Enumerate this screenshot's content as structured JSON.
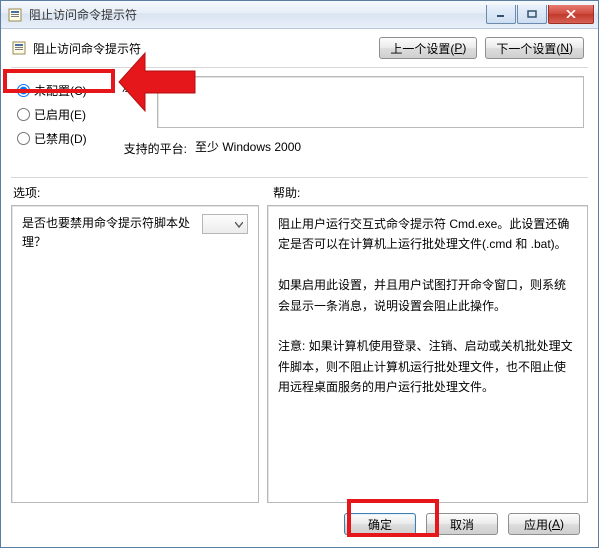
{
  "window": {
    "title": "阻止访问命令提示符"
  },
  "header": {
    "title": "阻止访问命令提示符",
    "prev_label": "上一个设置(",
    "prev_key": "P",
    "next_label": "下一个设置(",
    "next_key": "N",
    "paren_close": ")"
  },
  "radios": {
    "not_configured": "未配置(",
    "not_configured_key": "C",
    "enabled": "已启用(",
    "enabled_key": "E",
    "disabled": "已禁用(",
    "disabled_key": "D",
    "paren_close": ")"
  },
  "labels": {
    "comment": "注释:",
    "supported": "支持的平台:",
    "options": "选项:",
    "help": "帮助:"
  },
  "values": {
    "supported_on": "至少 Windows 2000"
  },
  "options": {
    "question": "是否也要禁用命令提示符脚本处理？"
  },
  "help": {
    "text": "阻止用户运行交互式命令提示符 Cmd.exe。此设置还确定是否可以在计算机上运行批处理文件(.cmd 和 .bat)。\n\n如果启用此设置，并且用户试图打开命令窗口，则系统会显示一条消息，说明设置会阻止此操作。\n\n注意: 如果计算机使用登录、注销、启动或关机批处理文件脚本，则不阻止计算机运行批处理文件，也不阻止使用远程桌面服务的用户运行批处理文件。"
  },
  "footer": {
    "ok": "确定",
    "cancel": "取消",
    "apply": "应用(",
    "apply_key": "A",
    "paren_close": ")"
  }
}
